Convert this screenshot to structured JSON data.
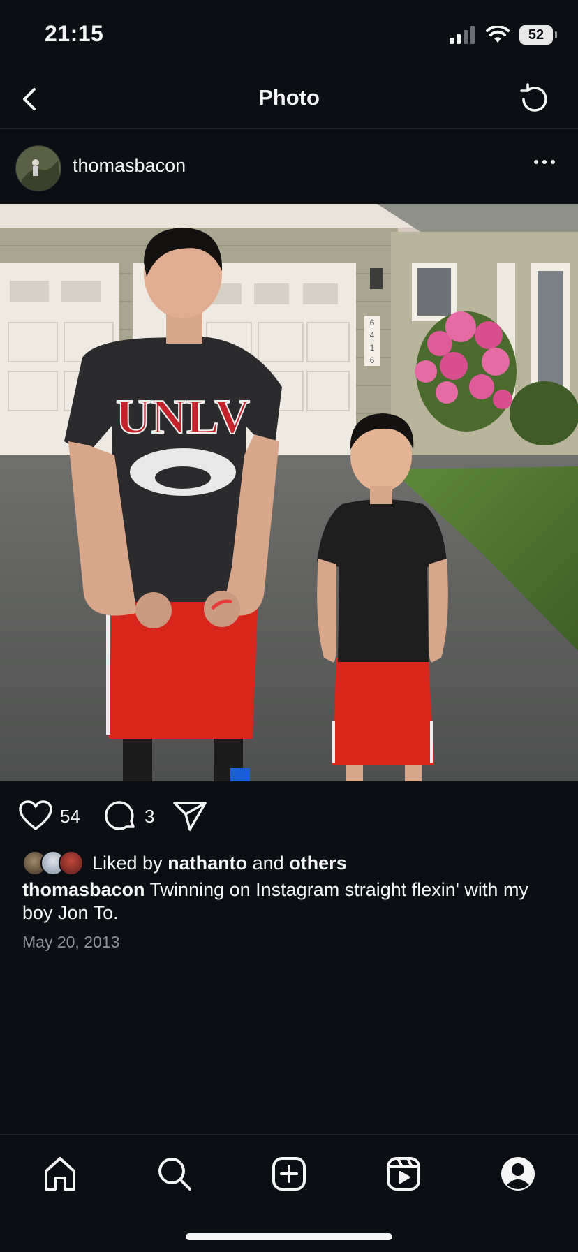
{
  "status_bar": {
    "time": "21:15",
    "battery": "52"
  },
  "header": {
    "title": "Photo"
  },
  "post": {
    "username": "thomasbacon",
    "likes": "54",
    "comments": "3",
    "liked_by_prefix": "Liked by",
    "liked_by_user": "nathanto",
    "liked_by_and": "and",
    "liked_by_others": "others",
    "caption_user": "thomasbacon",
    "caption_text": "Twinning on Instagram straight flexin' with my boy Jon To.",
    "date": "May 20, 2013",
    "photo_shirt_text": "UNLV",
    "photo_house_number": "6 4 1 6"
  },
  "tab_bar": {
    "tabs": [
      "home-icon",
      "search-icon",
      "create-icon",
      "reels-icon",
      "profile-icon"
    ]
  },
  "colors": {
    "background": "#0b0f14",
    "text": "#f5f5f5",
    "muted": "#8e9297",
    "shorts_red": "#d9261d"
  }
}
